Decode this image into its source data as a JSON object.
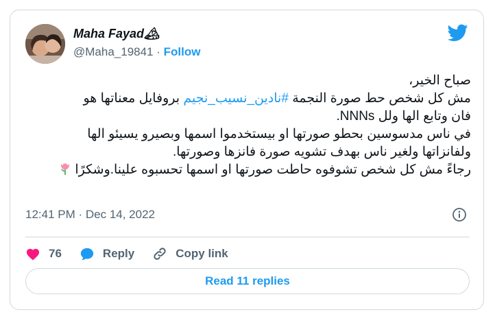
{
  "author": {
    "name": "Maha Fayad",
    "name_emoji": "🏔",
    "handle": "@Maha_19841",
    "separator": "·",
    "follow_label": "Follow"
  },
  "tweet": {
    "line1": "صباح الخير،",
    "line2_before": "مش كل شخص حط صورة النجمة ",
    "hashtag": "#نادين_نسيب_نجيم",
    "line2_after": " بروفايل معناتها هو",
    "line3": "فان وتابع الها ولل NNNs.",
    "line4": "في ناس مدسوسين بحطو صورتها او بيستخدموا اسمها وبصيرو يسيئو الها",
    "line5": "ولفانزاتها ولغير ناس بهدف تشويه صورة فانزها وصورتها.",
    "line6": "رجاءً مش كل شخص تشوفوه حاطت صورتها او اسمها تحسبوه علينا.وشكرًا"
  },
  "timestamp": "12:41 PM · Dec 14, 2022",
  "actions": {
    "likes_count": "76",
    "reply_label": "Reply",
    "copy_link_label": "Copy link"
  },
  "read_replies_label": "Read 11 replies",
  "colors": {
    "accent": "#1d9bf0",
    "like": "#f91880",
    "muted": "#536471",
    "border": "#cfd9de"
  },
  "icons": [
    "twitter-bird-icon",
    "heart-icon",
    "speech-bubble-icon",
    "link-icon",
    "info-icon",
    "tulip-icon"
  ]
}
